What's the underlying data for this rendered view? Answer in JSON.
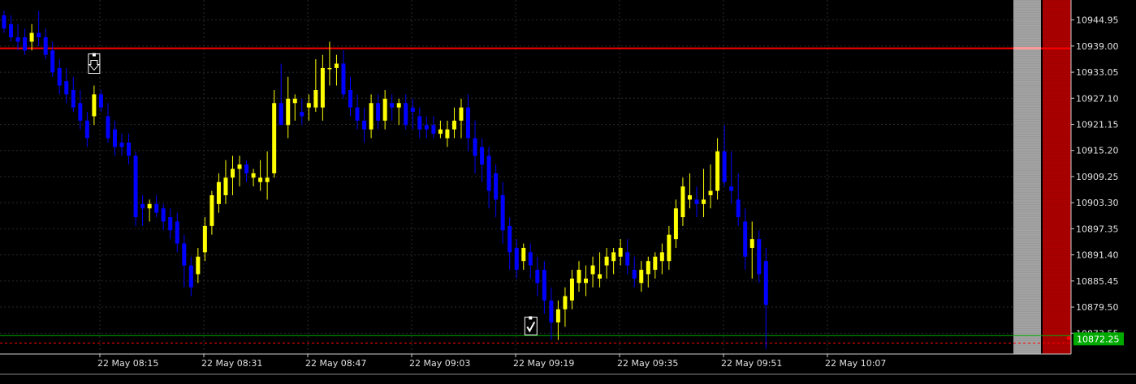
{
  "chart_data": {
    "type": "candlestick",
    "y_axis_labels": [
      "10944.95",
      "10939.00",
      "10933.05",
      "10927.10",
      "10921.15",
      "10915.20",
      "10909.25",
      "10903.30",
      "10897.35",
      "10891.40",
      "10885.45",
      "10879.50",
      "10873.55"
    ],
    "x_axis_labels": [
      "22 May 08:15",
      "22 May 08:31",
      "22 May 08:47",
      "22 May 09:03",
      "22 May 09:19",
      "22 May 09:35",
      "22 May 09:51",
      "22 May 10:07"
    ],
    "ylim": [
      10868.8,
      10949.5
    ],
    "current_price": "10872.25",
    "lines": {
      "resistance": 10938.5,
      "support": 10873.0,
      "dashed": 10871.3
    },
    "colors": {
      "background": "#000000",
      "bull": "#ffff00",
      "bear": "#0000ff",
      "grid": "#2a2a2a",
      "axis_text": "#e0e0e0",
      "resistance": "#ff0000",
      "support": "#00aa00",
      "price_badge": "#00aa00",
      "red_band": "#a00000",
      "gray_band": "#9a9a9a"
    },
    "candles": [
      [
        10946,
        10947,
        10942,
        10943
      ],
      [
        10944,
        10946,
        10940,
        10941
      ],
      [
        10941,
        10944,
        10938,
        10940
      ],
      [
        10941,
        10943,
        10937,
        10938
      ],
      [
        10940,
        10944,
        10938,
        10942
      ],
      [
        10942,
        10947,
        10939,
        10941
      ],
      [
        10941,
        10943,
        10936,
        10937
      ],
      [
        10938,
        10940,
        10932,
        10933
      ],
      [
        10934,
        10936,
        10928,
        10930
      ],
      [
        10931,
        10934,
        10926,
        10928
      ],
      [
        10929,
        10932,
        10924,
        10925
      ],
      [
        10926,
        10929,
        10920,
        10922
      ],
      [
        10922,
        10924,
        10916,
        10918
      ],
      [
        10923,
        10930,
        10921,
        10928
      ],
      [
        10928,
        10929,
        10924,
        10925
      ],
      [
        10923,
        10926,
        10917,
        10918
      ],
      [
        10920,
        10922,
        10914,
        10916
      ],
      [
        10917,
        10919,
        10914,
        10916
      ],
      [
        10917,
        10919,
        10912,
        10914
      ],
      [
        10914,
        10915,
        10898,
        10900
      ],
      [
        10903,
        10905,
        10898,
        10902
      ],
      [
        10902,
        10904,
        10899,
        10903
      ],
      [
        10903,
        10905,
        10900,
        10901
      ],
      [
        10902,
        10903,
        10897,
        10899
      ],
      [
        10900,
        10902,
        10895,
        10897
      ],
      [
        10899,
        10901,
        10892,
        10894
      ],
      [
        10894,
        10896,
        10884,
        10889
      ],
      [
        10889,
        10891,
        10882,
        10884
      ],
      [
        10887,
        10893,
        10885,
        10891
      ],
      [
        10892,
        10900,
        10890,
        10898
      ],
      [
        10898,
        10906,
        10896,
        10905
      ],
      [
        10903,
        10910,
        10901,
        10908
      ],
      [
        10905,
        10913,
        10903,
        10909
      ],
      [
        10909,
        10914,
        10905,
        10911
      ],
      [
        10911,
        10914,
        10907,
        10912
      ],
      [
        10912,
        10913,
        10908,
        10910
      ],
      [
        10909,
        10911,
        10907,
        10910
      ],
      [
        10908,
        10913,
        10906,
        10909
      ],
      [
        10908,
        10915,
        10904,
        10909
      ],
      [
        10910,
        10929,
        10909,
        10926
      ],
      [
        10926,
        10935,
        10922,
        10921
      ],
      [
        10921,
        10932,
        10918,
        10927
      ],
      [
        10926,
        10928,
        10922,
        10927
      ],
      [
        10924,
        10927,
        10921,
        10923
      ],
      [
        10925,
        10928,
        10922,
        10926
      ],
      [
        10925,
        10936,
        10924,
        10929
      ],
      [
        10925,
        10937,
        10922,
        10934
      ],
      [
        10934,
        10940,
        10930,
        10934
      ],
      [
        10934,
        10937,
        10930,
        10935
      ],
      [
        10935,
        10938,
        10927,
        10928
      ],
      [
        10929,
        10932,
        10923,
        10925
      ],
      [
        10925,
        10928,
        10920,
        10922
      ],
      [
        10922,
        10925,
        10917,
        10920
      ],
      [
        10920,
        10928,
        10918,
        10926
      ],
      [
        10926,
        10928,
        10920,
        10922
      ],
      [
        10922,
        10929,
        10920,
        10927
      ],
      [
        10926,
        10928,
        10922,
        10925
      ],
      [
        10925,
        10927,
        10921,
        10926
      ],
      [
        10926,
        10928,
        10920,
        10921
      ],
      [
        10925,
        10927,
        10920,
        10924
      ],
      [
        10923,
        10925,
        10918,
        10920
      ],
      [
        10921,
        10923,
        10918,
        10920
      ],
      [
        10921,
        10923,
        10918,
        10919
      ],
      [
        10919,
        10922,
        10918,
        10920
      ],
      [
        10918,
        10922,
        10916,
        10920
      ],
      [
        10920,
        10925,
        10918,
        10922
      ],
      [
        10922,
        10927,
        10918,
        10925
      ],
      [
        10925,
        10928,
        10915,
        10918
      ],
      [
        10918,
        10922,
        10910,
        10914
      ],
      [
        10916,
        10918,
        10908,
        10912
      ],
      [
        10914,
        10916,
        10902,
        10906
      ],
      [
        10910,
        10912,
        10900,
        10904
      ],
      [
        10905,
        10908,
        10894,
        10897
      ],
      [
        10898,
        10900,
        10888,
        10892
      ],
      [
        10893,
        10895,
        10886,
        10888
      ],
      [
        10890,
        10894,
        10888,
        10893
      ],
      [
        10892,
        10894,
        10886,
        10889
      ],
      [
        10888,
        10891,
        10882,
        10885
      ],
      [
        10888,
        10890,
        10878,
        10881
      ],
      [
        10881,
        10884,
        10872,
        10876
      ],
      [
        10876,
        10881,
        10872,
        10879
      ],
      [
        10879,
        10884,
        10875,
        10882
      ],
      [
        10881,
        10888,
        10879,
        10886
      ],
      [
        10885,
        10890,
        10883,
        10888
      ],
      [
        10885,
        10889,
        10882,
        10886
      ],
      [
        10887,
        10891,
        10884,
        10889
      ],
      [
        10886,
        10892,
        10884,
        10887
      ],
      [
        10889,
        10893,
        10886,
        10891
      ],
      [
        10890,
        10893,
        10887,
        10892
      ],
      [
        10891,
        10895,
        10889,
        10893
      ],
      [
        10892,
        10895,
        10887,
        10889
      ],
      [
        10888,
        10891,
        10884,
        10886
      ],
      [
        10885,
        10890,
        10883,
        10888
      ],
      [
        10887,
        10891,
        10884,
        10890
      ],
      [
        10888,
        10892,
        10886,
        10891
      ],
      [
        10890,
        10894,
        10887,
        10892
      ],
      [
        10890,
        10898,
        10888,
        10896
      ],
      [
        10895,
        10904,
        10893,
        10902
      ],
      [
        10900,
        10909,
        10898,
        10907
      ],
      [
        10904,
        10910,
        10902,
        10905
      ],
      [
        10904,
        10907,
        10900,
        10903
      ],
      [
        10903,
        10911,
        10900,
        10904
      ],
      [
        10905,
        10912,
        10902,
        10906
      ],
      [
        10906,
        10918,
        10904,
        10915
      ],
      [
        10915,
        10921,
        10907,
        10908
      ],
      [
        10907,
        10915,
        10903,
        10906
      ],
      [
        10904,
        10910,
        10898,
        10900
      ],
      [
        10899,
        10902,
        10888,
        10891
      ],
      [
        10893,
        10899,
        10886,
        10895
      ],
      [
        10895,
        10897,
        10885,
        10887
      ],
      [
        10890,
        10893,
        10870,
        10880
      ]
    ],
    "annotations": [
      {
        "type": "sell-arrow",
        "candle": 13,
        "price": 10935
      },
      {
        "type": "check",
        "candle": 76,
        "price": 10875
      }
    ]
  }
}
